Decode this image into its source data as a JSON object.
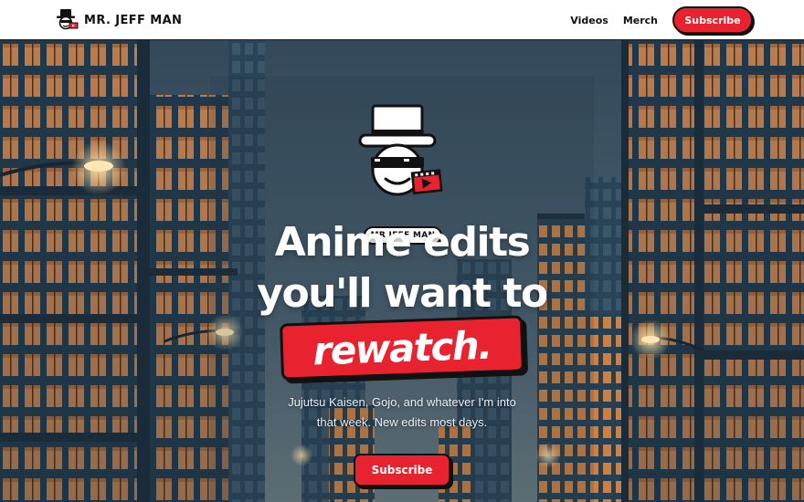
{
  "brand": {
    "name": "MR. JEFF MAN",
    "logo_icon": "top-hat-mascot-icon"
  },
  "nav": {
    "links": [
      {
        "label": "Videos"
      },
      {
        "label": "Merch"
      }
    ],
    "subscribe_label": "Subscribe"
  },
  "hero": {
    "badge": "MR JEFF MAN",
    "headline_line1": "Anime edits",
    "headline_line2": "you'll want to",
    "highlight_word": "rewatch.",
    "subtitle_line1": "Jujutsu Kaisen, Gojo, and whatever I'm into",
    "subtitle_line2": "that week. New edits most days.",
    "cta_label": "Subscribe",
    "background_scene": "anime-city-street-at-dusk",
    "mascot_icon": "top-hat-sunglasses-mascot-icon"
  },
  "colors": {
    "accent_red": "#e8232f",
    "ink": "#111111",
    "nav_bg": "#ffffff",
    "sky": "#3d5566",
    "building_dark": "#1f3546",
    "window_warm": "#e0925a"
  }
}
